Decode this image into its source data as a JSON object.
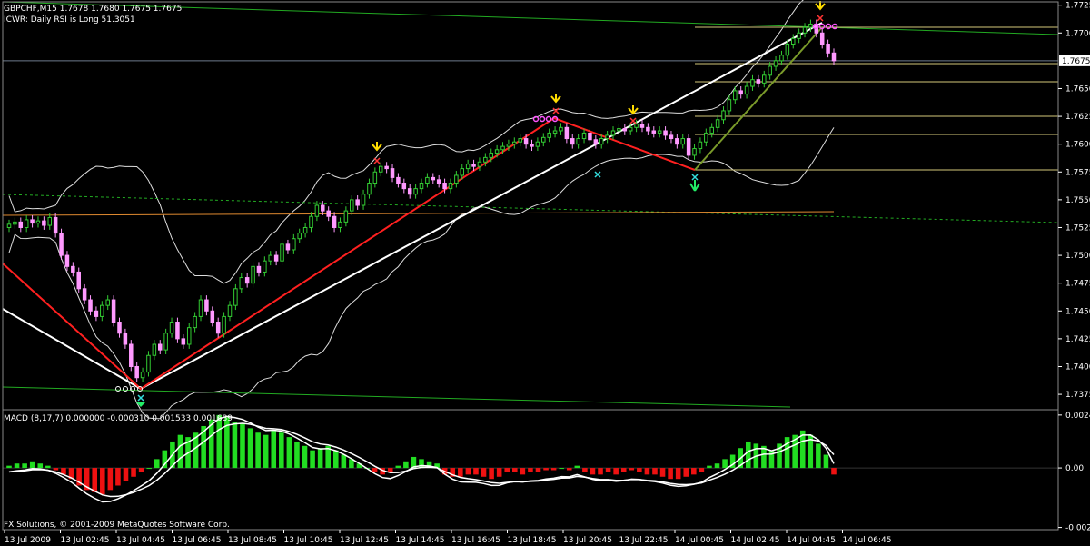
{
  "header": {
    "symbol_line": "GBPCHF,M15  1.7678 1.7680 1.7675 1.7675",
    "indicator_line": "ICWR: Daily RSI is Long 51.3051"
  },
  "macd": {
    "label": "MACD (8,17,7) 0.000000 -0.000310 0.001533 0.001689"
  },
  "footer": {
    "copyright": "FX Solutions, © 2001-2009 MetaQuotes Software Corp."
  },
  "current_price_label": "1.7675",
  "colors": {
    "background": "#000000",
    "bull_candle": "#33cc33",
    "bear_candle": "#ff99ff",
    "red_zigzag": "#ff2020",
    "white_trend": "#ffffff",
    "green_line": "#22aa22",
    "fib_line": "#d4c87a",
    "orange_line": "#e08a30",
    "bollinger": "#dddddd",
    "macd_pos": "#22dd22",
    "macd_neg": "#ee1111",
    "arrow_yellow": "#ffdd00"
  },
  "chart_data": [
    {
      "type": "candlestick",
      "ylim": [
        1.7362,
        1.7728
      ],
      "price_ticks": [
        "1.7725",
        "1.7700",
        "1.7650",
        "1.7625",
        "1.7600",
        "1.7575",
        "1.7550",
        "1.7525",
        "1.7500",
        "1.7475",
        "1.7450",
        "1.7425",
        "1.7400",
        "1.7375"
      ],
      "x_labels": [
        "13 Jul 2009",
        "13 Jul 02:45",
        "13 Jul 04:45",
        "13 Jul 06:45",
        "13 Jul 08:45",
        "13 Jul 10:45",
        "13 Jul 12:45",
        "13 Jul 14:45",
        "13 Jul 16:45",
        "13 Jul 18:45",
        "13 Jul 20:45",
        "13 Jul 22:45",
        "14 Jul 00:45",
        "14 Jul 02:45",
        "14 Jul 04:45",
        "14 Jul 06:45"
      ],
      "close": [
        1.7528,
        1.753,
        1.7525,
        1.7532,
        1.7529,
        1.7531,
        1.7527,
        1.7534,
        1.752,
        1.75,
        1.749,
        1.7485,
        1.747,
        1.746,
        1.745,
        1.7445,
        1.7455,
        1.746,
        1.744,
        1.743,
        1.742,
        1.74,
        1.739,
        1.7395,
        1.741,
        1.742,
        1.7415,
        1.743,
        1.744,
        1.7425,
        1.742,
        1.7435,
        1.7445,
        1.746,
        1.745,
        1.744,
        1.743,
        1.7445,
        1.7455,
        1.747,
        1.748,
        1.7475,
        1.749,
        1.7485,
        1.7495,
        1.75,
        1.7495,
        1.751,
        1.7505,
        1.7515,
        1.752,
        1.7525,
        1.7535,
        1.7545,
        1.754,
        1.7535,
        1.7525,
        1.753,
        1.754,
        1.755,
        1.7545,
        1.7555,
        1.7565,
        1.7575,
        1.758,
        1.7578,
        1.757,
        1.7565,
        1.756,
        1.7555,
        1.756,
        1.7565,
        1.757,
        1.7568,
        1.7565,
        1.756,
        1.7565,
        1.7572,
        1.7578,
        1.7582,
        1.758,
        1.7584,
        1.7588,
        1.7592,
        1.7595,
        1.7598,
        1.76,
        1.7602,
        1.7605,
        1.76,
        1.7598,
        1.7602,
        1.7606,
        1.761,
        1.7612,
        1.7615,
        1.7605,
        1.76,
        1.7605,
        1.761,
        1.7604,
        1.76,
        1.7605,
        1.7608,
        1.7612,
        1.7614,
        1.7612,
        1.7615,
        1.7618,
        1.7615,
        1.7612,
        1.761,
        1.7612,
        1.7608,
        1.7605,
        1.76,
        1.7605,
        1.759,
        1.7596,
        1.7602,
        1.761,
        1.7615,
        1.7622,
        1.763,
        1.764,
        1.7648,
        1.7645,
        1.7652,
        1.7658,
        1.7655,
        1.7662,
        1.767,
        1.7675,
        1.768,
        1.769,
        1.7695,
        1.77,
        1.7705,
        1.7708,
        1.77,
        1.769,
        1.7682,
        1.7675
      ]
    },
    {
      "type": "bar",
      "name": "MACD",
      "ylim": [
        -0.0028,
        0.0026
      ],
      "ticks": [
        "0.0024",
        "0.00",
        "-0.0027"
      ],
      "values": [
        0.0001,
        0.0002,
        0.0002,
        0.0003,
        0.0002,
        0.0001,
        -0.0001,
        -0.0003,
        -0.0005,
        -0.0008,
        -0.001,
        -0.0011,
        -0.0012,
        -0.001,
        -0.0008,
        -0.0006,
        -0.0004,
        -0.0002,
        0.0,
        0.0004,
        0.0008,
        0.0012,
        0.0015,
        0.0014,
        0.0016,
        0.0019,
        0.0022,
        0.0024,
        0.0023,
        0.0021,
        0.002,
        0.0018,
        0.0016,
        0.0015,
        0.0017,
        0.0016,
        0.0014,
        0.0012,
        0.001,
        0.0008,
        0.0009,
        0.001,
        0.0008,
        0.0006,
        0.0004,
        0.0002,
        0.0,
        -0.0002,
        -0.0003,
        -0.0002,
        0.0001,
        0.0003,
        0.0005,
        0.0004,
        0.0003,
        0.0002,
        -0.0003,
        -0.0004,
        -0.0004,
        -0.0003,
        -0.0003,
        -0.0004,
        -0.0005,
        -0.0004,
        -0.0002,
        -0.0002,
        -0.0003,
        -0.0002,
        -0.0002,
        -0.0001,
        -0.0001,
        0.0,
        -0.0001,
        0.0001,
        -0.0002,
        -0.0003,
        -0.0003,
        -0.0002,
        -0.0003,
        -0.0002,
        -0.0001,
        -0.0002,
        -0.0003,
        -0.0003,
        -0.0004,
        -0.0005,
        -0.0005,
        -0.0004,
        -0.0003,
        -0.0002,
        0.0001,
        0.0002,
        0.0004,
        0.0006,
        0.0009,
        0.0012,
        0.0011,
        0.001,
        0.0008,
        0.0011,
        0.0014,
        0.0015,
        0.0017,
        0.0015,
        0.0011,
        0.0006,
        -0.0003
      ]
    }
  ]
}
